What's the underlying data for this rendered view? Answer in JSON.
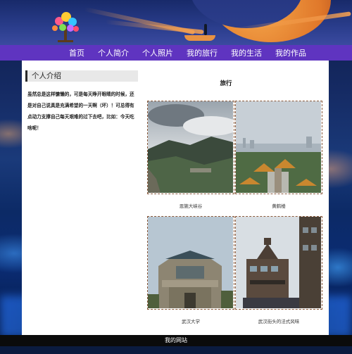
{
  "site": {
    "nav": [
      "首页",
      "个人简介",
      "个人照片",
      "我的旅行",
      "我的生活",
      "我的作品"
    ],
    "footer": "我的网站"
  },
  "sidebar": {
    "title": "个人介绍",
    "text": "虽然总是这样慵懒的，可是每天睁开眼睛的时候，还是对自己说真是充满希望的一天啊（坏）！可总得有点动力支撑自己每天艰难的过下去吧，比如：今天吃啥呢！"
  },
  "gallery": {
    "title": "旅行",
    "photos": [
      {
        "caption": "恩施大峡谷",
        "icon": "mountain-valley-photo"
      },
      {
        "caption": "黄鹤楼",
        "icon": "yellow-crane-tower-photo"
      },
      {
        "caption": "武汉大学",
        "icon": "wuhan-university-gate-photo"
      },
      {
        "caption": "武汉街头的法式风味",
        "icon": "french-style-street-photo"
      }
    ]
  },
  "colors": {
    "nav_bg": "#5f34c0",
    "frame_border": "#8a5a3c",
    "moon": "#f5a64a"
  }
}
